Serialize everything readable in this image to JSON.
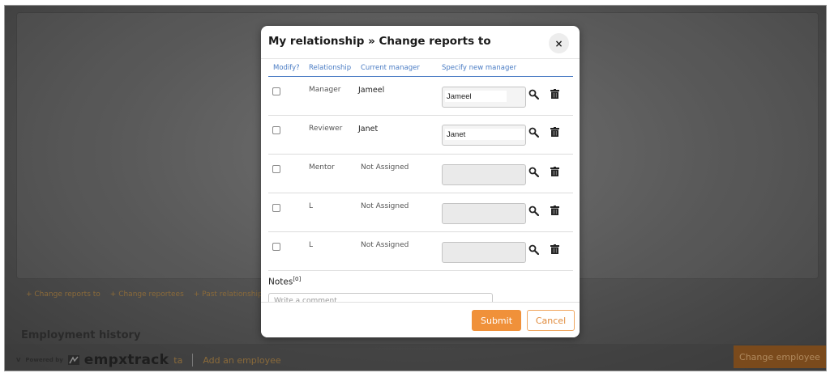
{
  "modal": {
    "title": "My relationship » Change reports to",
    "close_icon": "×",
    "columns": {
      "modify": "Modify?",
      "relationship": "Relationship",
      "current_manager": "Current manager",
      "new_manager": "Specify new manager"
    },
    "rows": [
      {
        "relationship": "Manager",
        "current_manager": "Jameel",
        "new_manager": "Jameel"
      },
      {
        "relationship": "Reviewer",
        "current_manager": "Janet",
        "new_manager": "Janet"
      },
      {
        "relationship": "Mentor",
        "current_manager": "Not Assigned",
        "new_manager": ""
      },
      {
        "relationship": "L",
        "current_manager": "Not Assigned",
        "new_manager": ""
      },
      {
        "relationship": "L",
        "current_manager": "Not Assigned",
        "new_manager": ""
      }
    ],
    "notes_label": "Notes",
    "notes_count": "[0]",
    "comment_placeholder": "Write a comment",
    "submit_label": "Submit",
    "cancel_label": "Cancel"
  },
  "background": {
    "links": [
      "+ Change reports to",
      "+ Change reportees",
      "+ Past relationship"
    ],
    "section_title": "Employment history",
    "powered_by": "Powered by",
    "brand": "empxtrack",
    "footer_prefix": "V",
    "footer_fragment": "ta",
    "add_employee": "Add an employee",
    "change_employee": "Change employee"
  },
  "colors": {
    "accent": "#f0913a",
    "header_blue": "#4a7cc4"
  },
  "icons": {
    "search": "search-icon",
    "delete": "trash-icon",
    "close": "close-icon"
  }
}
